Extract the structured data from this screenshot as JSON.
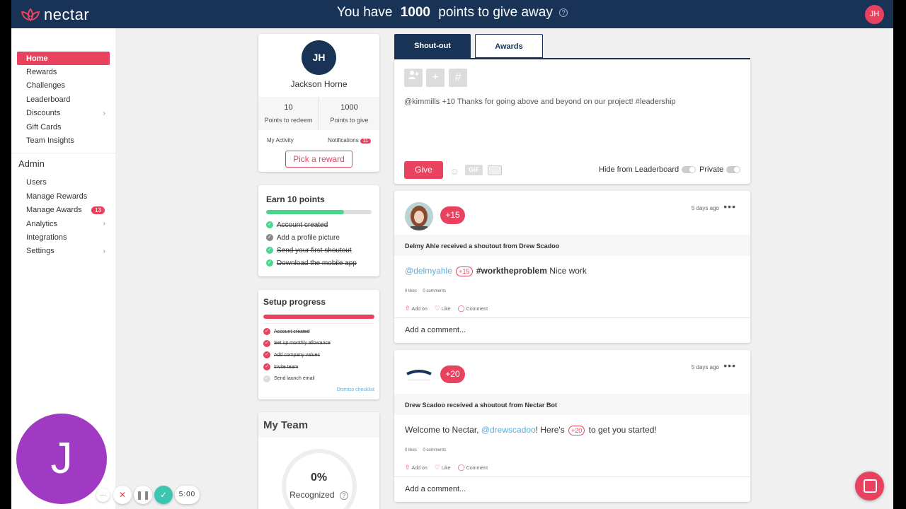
{
  "header": {
    "logo_text": "nectar",
    "msg_prefix": "You have",
    "msg_points": "1000",
    "msg_suffix": "points to give away",
    "help_icon": "?",
    "avatar_initials": "JH"
  },
  "sidebar": {
    "items": [
      {
        "label": "Home",
        "active": true
      },
      {
        "label": "Rewards"
      },
      {
        "label": "Challenges"
      },
      {
        "label": "Leaderboard"
      },
      {
        "label": "Discounts",
        "chevron": "›"
      },
      {
        "label": "Gift Cards"
      },
      {
        "label": "Team Insights"
      }
    ],
    "admin_heading": "Admin",
    "admin_items": [
      {
        "label": "Users"
      },
      {
        "label": "Manage Rewards"
      },
      {
        "label": "Manage Awards",
        "badge": "13"
      },
      {
        "label": "Analytics",
        "chevron": "›"
      },
      {
        "label": "Integrations"
      },
      {
        "label": "Settings",
        "chevron": "›"
      }
    ]
  },
  "profile": {
    "initials": "JH",
    "name": "Jackson Horne",
    "redeem_value": "10",
    "redeem_label": "Points to redeem",
    "give_value": "1000",
    "give_label": "Points to give",
    "my_activity": "My Activity",
    "notifications": "Notifications",
    "notifications_count": "11",
    "pick_reward": "Pick a reward"
  },
  "earn": {
    "title": "Earn 10 points",
    "progress": 0.74,
    "items": [
      {
        "label": "Account created",
        "done": true
      },
      {
        "label": "Add a profile picture",
        "done": false
      },
      {
        "label": "Send your first shoutout",
        "done": true
      },
      {
        "label": "Download the mobile app",
        "done": true
      }
    ]
  },
  "setup": {
    "title": "Setup progress",
    "progress": 1.0,
    "items": [
      {
        "label": "Account created",
        "done": true
      },
      {
        "label": "Set up monthly allowance",
        "done": true
      },
      {
        "label": "Add company values",
        "done": true
      },
      {
        "label": "Invite team",
        "done": true
      },
      {
        "label": "Send launch email",
        "done": false
      }
    ],
    "dismiss": "Dismiss checklist"
  },
  "myteam": {
    "title": "My Team",
    "percent": "0%",
    "label": "Recognized"
  },
  "tabs": {
    "shoutout": "Shout-out",
    "awards": "Awards"
  },
  "composer": {
    "text": "@kimmills +10 Thanks for going above and beyond on our project! #leadership",
    "give": "Give",
    "gif": "GIF",
    "hide_leaderboard": "Hide from Leaderboard",
    "private": "Private"
  },
  "posts": [
    {
      "points": "+15",
      "time": "5 days ago",
      "headline": "Delmy Ahle received a shoutout from Drew Scadoo",
      "mention": "@delmyahle",
      "inline_points": "+15",
      "hashtag": "#worktheproblem",
      "rest": "Nice work",
      "likes": "0 likes",
      "comments": "0 comments",
      "add_on": "Add on",
      "like": "Like",
      "comment": "Comment",
      "add_comment": "Add a comment..."
    },
    {
      "points": "+20",
      "time": "5 days ago",
      "headline": "Drew Scadoo received a shoutout from Nectar Bot",
      "pre": "Welcome to Nectar, ",
      "mention": "@drewscadoo",
      "mid": "! Here's ",
      "inline_points": "+20",
      "rest": " to get you started!",
      "likes": "0 likes",
      "comments": "0 comments",
      "add_on": "Add on",
      "like": "Like",
      "comment": "Comment",
      "add_comment": "Add a comment..."
    }
  ],
  "overlay": {
    "avatar_letter": "J",
    "timer": "5:00",
    "more": "···"
  },
  "colors": {
    "navy": "#183356",
    "accent": "#e8425e",
    "green": "#4ad68a",
    "mention": "#5aaed8",
    "overlay_purple": "#a13ac2"
  }
}
